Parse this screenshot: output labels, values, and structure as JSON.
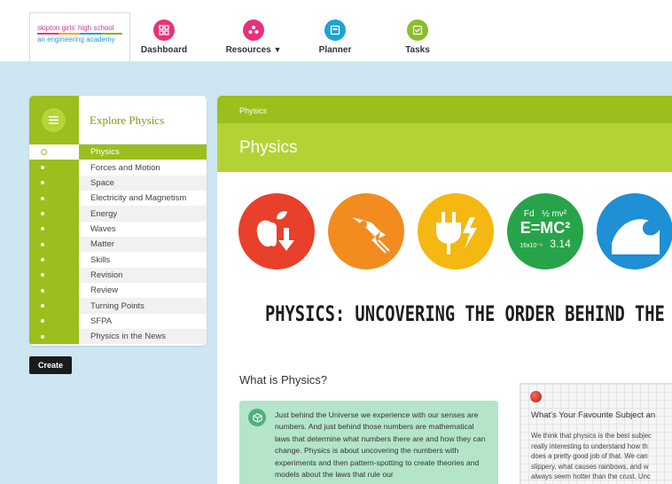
{
  "logo": {
    "line1": "skipton girls' high school",
    "line2": "an engineering academy"
  },
  "nav": [
    {
      "label": "Dashboard",
      "icon": "dashboard-grid-icon",
      "color": "#e8317a"
    },
    {
      "label": "Resources",
      "icon": "resources-icon",
      "color": "#e8317a"
    },
    {
      "label": "Planner",
      "icon": "planner-icon",
      "color": "#1aa4d8"
    },
    {
      "label": "Tasks",
      "icon": "tasks-check-icon",
      "color": "#8bbd2e"
    }
  ],
  "sidebar": {
    "title": "Explore Physics",
    "menu_icon": "hamburger-menu-icon",
    "items": [
      {
        "label": "Physics",
        "active": true
      },
      {
        "label": "Forces and Motion"
      },
      {
        "label": "Space"
      },
      {
        "label": "Electricity and Magnetism"
      },
      {
        "label": "Energy"
      },
      {
        "label": "Waves"
      },
      {
        "label": "Matter"
      },
      {
        "label": "Skills"
      },
      {
        "label": "Revision"
      },
      {
        "label": "Review"
      },
      {
        "label": "Turning Points"
      },
      {
        "label": "SFPA"
      },
      {
        "label": "Physics in the News"
      }
    ]
  },
  "create_label": "Create",
  "main": {
    "breadcrumb": "Physics",
    "title": "Physics",
    "banner": {
      "circles": [
        {
          "icon": "apple-falling-icon",
          "color": "#e8402a"
        },
        {
          "icon": "rocket-icon",
          "color": "#f28c1e"
        },
        {
          "icon": "plug-lightning-icon",
          "color": "#f5b812"
        },
        {
          "icon": "formula-icon",
          "color": "#27a44a",
          "text": {
            "fd": "Fd",
            "half": "½ mv²",
            "emc": "E=MC²",
            "sci": "16x10⁻⁶",
            "pi": "3.14"
          }
        },
        {
          "icon": "wave-icon",
          "color": "#1f8fd6"
        }
      ],
      "headline": "PHYSICS: UNCOVERING THE ORDER BEHIND THE U"
    },
    "what_is_heading": "What is Physics?",
    "what_is_text": "Just behind the Universe we experience with our senses are numbers. And just behind those numbers are mathematical laws that determine what numbers there are and how they can change. Physics is about uncovering the numbers with experiments and then pattern-spotting to create theories and models about the laws that rule our",
    "note": {
      "heading": "What's Your Favourite Subject an",
      "lines": [
        "We think that physics is the best subjec",
        "really interesting to understand how th",
        "does a pretty good job of that. We can",
        "slippery, what causes rainbows, and w",
        "always seem hotter than the crust. Unc"
      ]
    }
  }
}
